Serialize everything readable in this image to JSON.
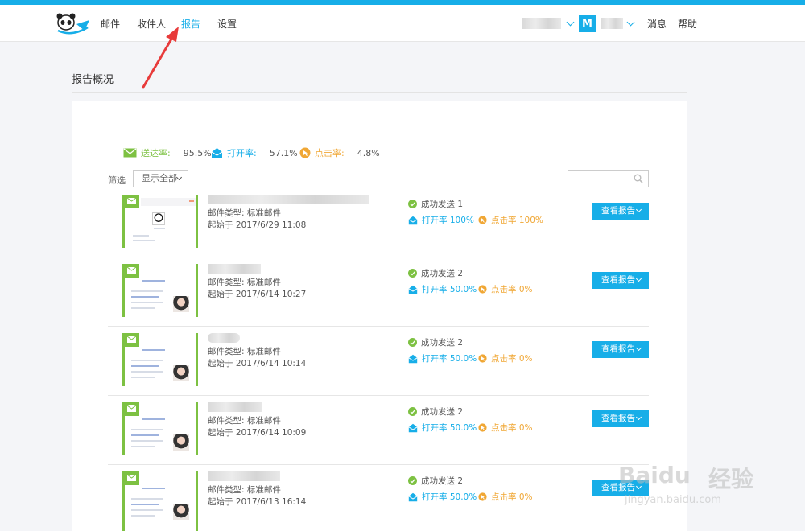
{
  "nav": {
    "links": [
      "邮件",
      "收件人",
      "报告",
      "设置"
    ],
    "active": "报告",
    "account_initial": "M",
    "right_links": [
      "消息",
      "帮助"
    ]
  },
  "page": {
    "title": "报告概况"
  },
  "stats": {
    "delivery": {
      "label": "送达率:",
      "value": "95.5%",
      "color": "#7dc142"
    },
    "open": {
      "label": "打开率:",
      "value": "57.1%",
      "color": "#17aee8"
    },
    "click": {
      "label": "点击率:",
      "value": "4.8%",
      "color": "#f0a735"
    }
  },
  "filter": {
    "label": "筛选",
    "selected": "显示全部"
  },
  "reports": [
    {
      "type": "邮件类型: 标准邮件",
      "start": "起始于 2017/6/29 11:08",
      "sent": "成功发送 1",
      "open": "打开率 100%",
      "click": "点击率 100%",
      "button": "查看报告"
    },
    {
      "type": "邮件类型: 标准邮件",
      "start": "起始于 2017/6/14 10:27",
      "sent": "成功发送 2",
      "open": "打开率 50.0%",
      "click": "点击率 0%",
      "button": "查看报告"
    },
    {
      "type": "邮件类型: 标准邮件",
      "start": "起始于 2017/6/14 10:14",
      "sent": "成功发送 2",
      "open": "打开率 50.0%",
      "click": "点击率 0%",
      "button": "查看报告"
    },
    {
      "type": "邮件类型: 标准邮件",
      "start": "起始于 2017/6/14 10:09",
      "sent": "成功发送 2",
      "open": "打开率 50.0%",
      "click": "点击率 0%",
      "button": "查看报告"
    },
    {
      "type": "邮件类型: 标准邮件",
      "start": "起始于 2017/6/13 16:14",
      "sent": "成功发送 2",
      "open": "打开率 50.0%",
      "click": "点击率 0%",
      "button": "查看报告"
    }
  ],
  "colors": {
    "accent": "#17aee8",
    "success": "#7dc142",
    "warning": "#f0a735"
  },
  "watermark": {
    "brand": "Baidu",
    "cn": "经验",
    "url": "jingyan.baidu.com"
  }
}
